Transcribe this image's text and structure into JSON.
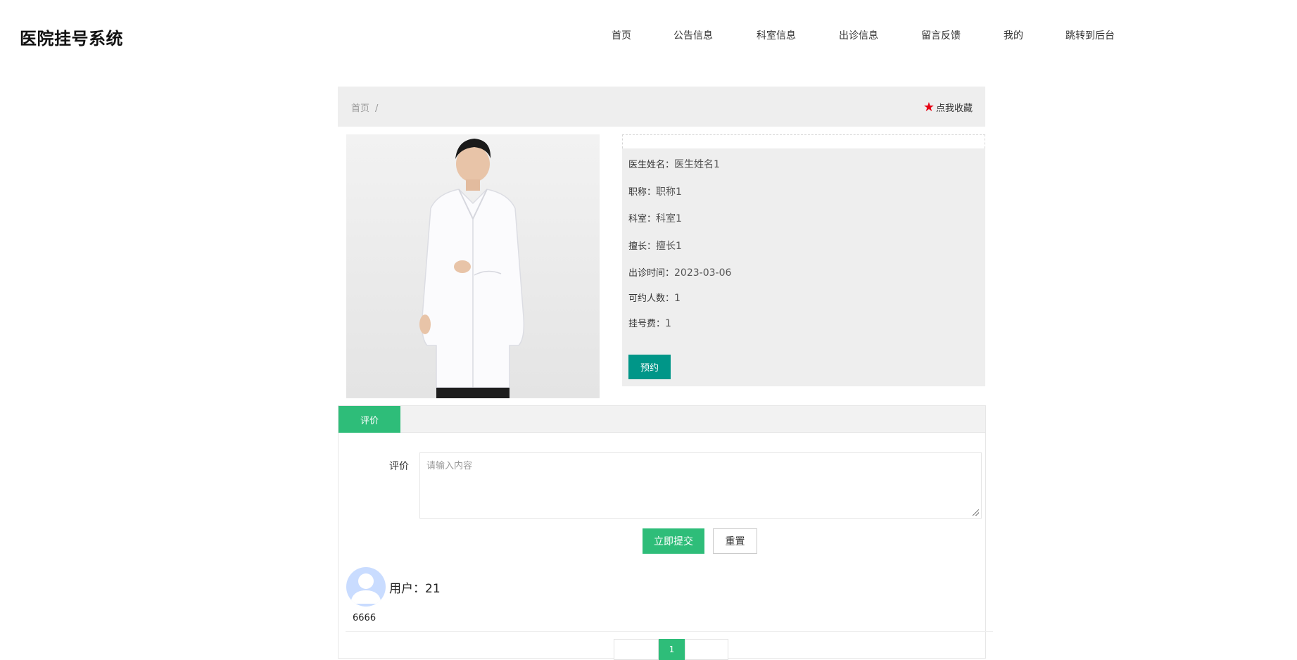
{
  "header": {
    "site_title": "医院挂号系统",
    "nav": [
      "首页",
      "公告信息",
      "科室信息",
      "出诊信息",
      "留言反馈",
      "我的",
      "跳转到后台"
    ]
  },
  "breadcrumb": {
    "home": "首页",
    "separator": "/"
  },
  "favorite": {
    "icon": "star-icon",
    "label": "点我收藏",
    "icon_color": "#e60012"
  },
  "doctor": {
    "photo": "doctor-photo",
    "fields": [
      {
        "label": "医生姓名：",
        "value": "医生姓名1"
      },
      {
        "label": "职称：",
        "value": "职称1"
      },
      {
        "label": "科室：",
        "value": "科室1"
      },
      {
        "label": "擅长：",
        "value": "擅长1"
      },
      {
        "label": "出诊时间：",
        "value": "2023-03-06"
      },
      {
        "label": "可约人数：",
        "value": "1"
      },
      {
        "label": "挂号费：",
        "value": "1"
      }
    ],
    "book_button": "预约"
  },
  "review": {
    "tab": "评价",
    "form_label": "评价",
    "placeholder": "请输入内容",
    "submit": "立即提交",
    "reset": "重置"
  },
  "comments": [
    {
      "user": "用户：21",
      "text": "6666"
    }
  ],
  "pagination": {
    "current": "1"
  },
  "colors": {
    "accent": "#2ebd79",
    "book_button": "#009688",
    "panel_bg": "#eeeeee"
  }
}
